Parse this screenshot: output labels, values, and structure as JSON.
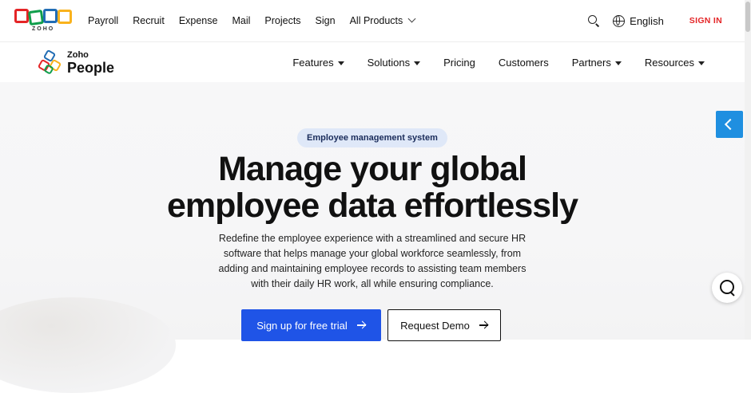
{
  "topbar": {
    "logo_text": "ZOHO",
    "nav": [
      "Payroll",
      "Recruit",
      "Expense",
      "Mail",
      "Projects",
      "Sign",
      "All Products"
    ],
    "language": "English",
    "signin": "SIGN IN"
  },
  "product": {
    "brand_small": "Zoho",
    "brand": "People",
    "nav": [
      {
        "label": "Features",
        "dropdown": true
      },
      {
        "label": "Solutions",
        "dropdown": true
      },
      {
        "label": "Pricing",
        "dropdown": false
      },
      {
        "label": "Customers",
        "dropdown": false
      },
      {
        "label": "Partners",
        "dropdown": true
      },
      {
        "label": "Resources",
        "dropdown": true
      }
    ]
  },
  "hero": {
    "badge": "Employee management system",
    "headline_line1": "Manage your global",
    "headline_line2": "employee data effortlessly",
    "subtext": "Redefine the employee experience with a streamlined and secure HR software that helps manage your global workforce seamlessly, from adding and maintaining employee records to assisting team members with their daily HR work, all while ensuring compliance.",
    "primary_cta": "Sign up for free trial",
    "secondary_cta": "Request Demo"
  },
  "colors": {
    "accent": "#1f54e7",
    "signin": "#e42527",
    "badge_bg": "#dfe8f8",
    "side_tab": "#1f8fe0"
  },
  "icons": [
    "search-icon",
    "globe-icon",
    "chevron-down-icon",
    "arrow-right-icon",
    "chevron-left-icon",
    "help-search-icon"
  ]
}
